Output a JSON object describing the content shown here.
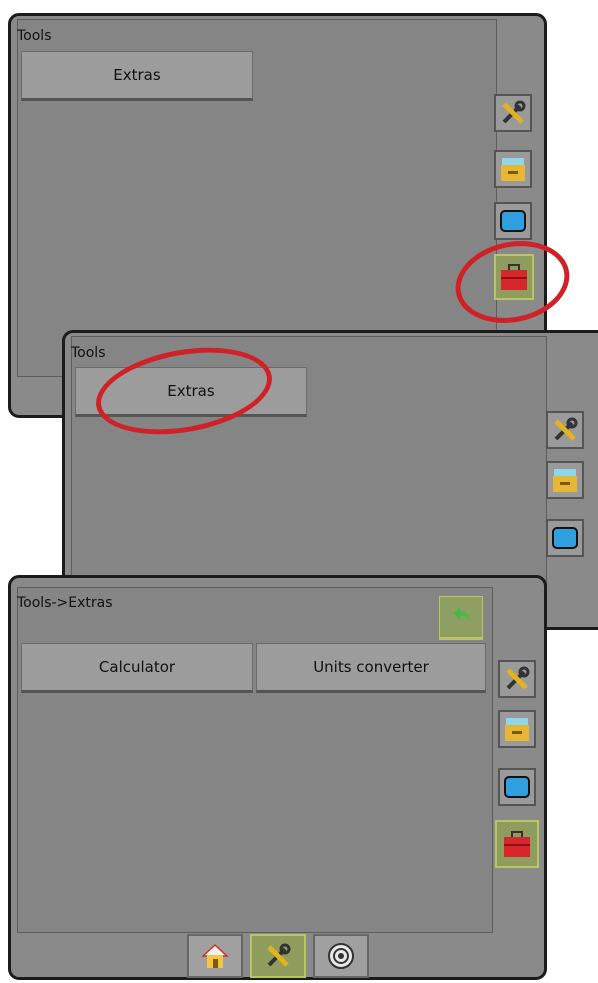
{
  "screen1": {
    "title": "Tools",
    "buttons": [
      {
        "label": "Extras"
      }
    ]
  },
  "screen2": {
    "title": "Tools",
    "buttons": [
      {
        "label": "Extras"
      }
    ]
  },
  "screen3": {
    "title": "Tools->Extras",
    "buttons": [
      {
        "label": "Calculator"
      },
      {
        "label": "Units converter"
      }
    ]
  },
  "side_icons": [
    "tools-wrench-screwdriver-icon",
    "storage-drawer-icon",
    "display-monitor-icon",
    "toolbox-icon"
  ],
  "bottom_tabs": [
    "home-icon",
    "tools-icon",
    "gauge-icon"
  ],
  "colors": {
    "highlight": "#d02127",
    "active": "#b9c463",
    "panel": "#858585"
  }
}
